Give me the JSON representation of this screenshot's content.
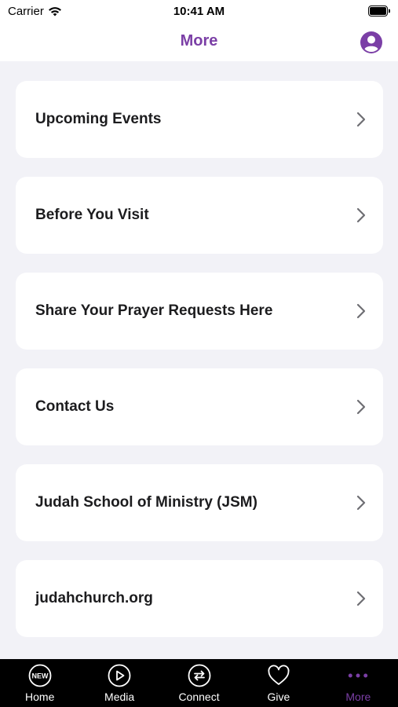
{
  "status_bar": {
    "carrier": "Carrier",
    "time": "10:41 AM"
  },
  "nav": {
    "title": "More"
  },
  "menu": [
    {
      "label": "Upcoming Events"
    },
    {
      "label": "Before You Visit"
    },
    {
      "label": "Share Your Prayer Requests Here"
    },
    {
      "label": "Contact Us"
    },
    {
      "label": "Judah School of Ministry (JSM)"
    },
    {
      "label": "judahchurch.org"
    }
  ],
  "tabs": [
    {
      "label": "Home",
      "icon": "new-badge-icon",
      "badge": "NEW"
    },
    {
      "label": "Media",
      "icon": "play-icon"
    },
    {
      "label": "Connect",
      "icon": "connect-icon"
    },
    {
      "label": "Give",
      "icon": "heart-icon"
    },
    {
      "label": "More",
      "icon": "more-dots-icon",
      "active": true
    }
  ],
  "colors": {
    "accent": "#7b3fa6",
    "background": "#f2f2f7",
    "tab_bar": "#000000"
  }
}
